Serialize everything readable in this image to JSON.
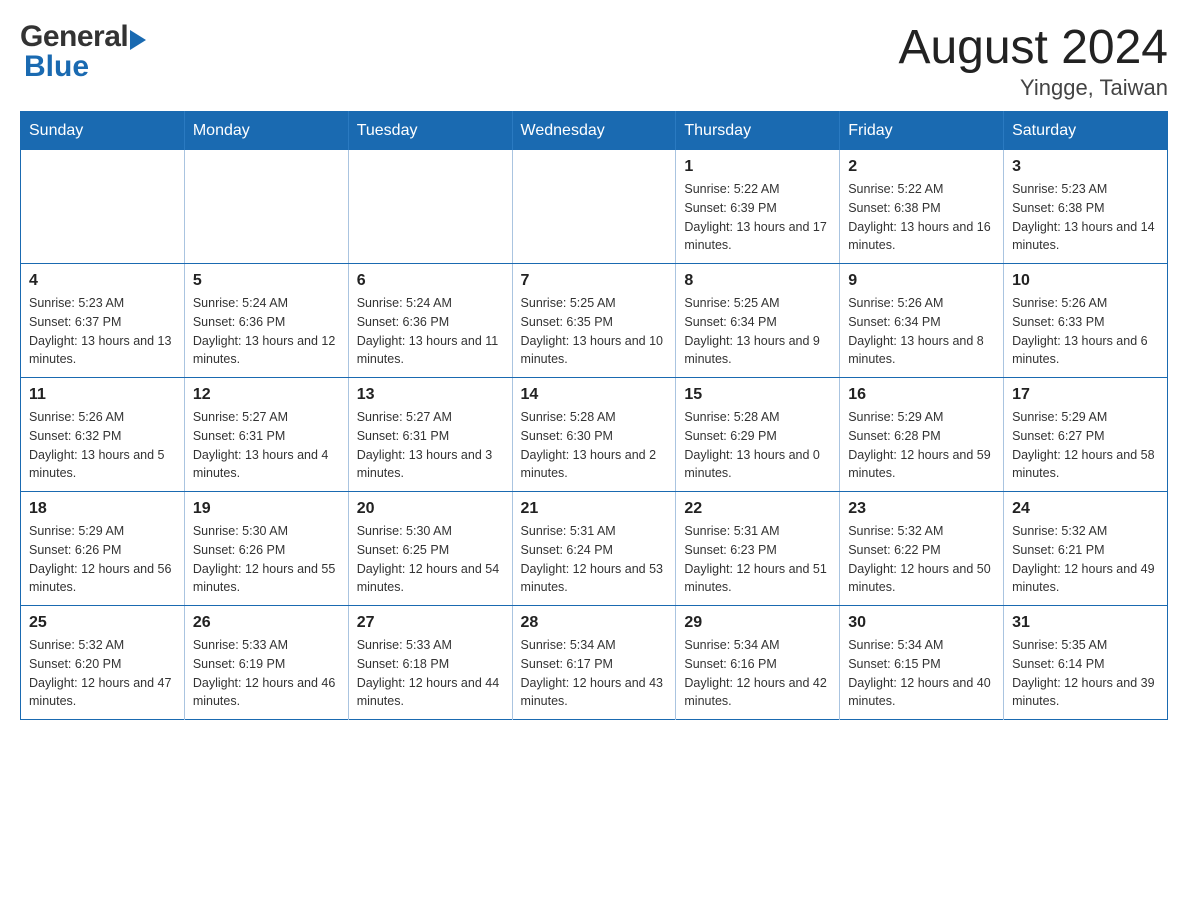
{
  "header": {
    "logo_general": "General",
    "logo_blue": "Blue",
    "title": "August 2024",
    "subtitle": "Yingge, Taiwan"
  },
  "weekdays": [
    "Sunday",
    "Monday",
    "Tuesday",
    "Wednesday",
    "Thursday",
    "Friday",
    "Saturday"
  ],
  "weeks": [
    [
      {
        "day": "",
        "sunrise": "",
        "sunset": "",
        "daylight": ""
      },
      {
        "day": "",
        "sunrise": "",
        "sunset": "",
        "daylight": ""
      },
      {
        "day": "",
        "sunrise": "",
        "sunset": "",
        "daylight": ""
      },
      {
        "day": "",
        "sunrise": "",
        "sunset": "",
        "daylight": ""
      },
      {
        "day": "1",
        "sunrise": "Sunrise: 5:22 AM",
        "sunset": "Sunset: 6:39 PM",
        "daylight": "Daylight: 13 hours and 17 minutes."
      },
      {
        "day": "2",
        "sunrise": "Sunrise: 5:22 AM",
        "sunset": "Sunset: 6:38 PM",
        "daylight": "Daylight: 13 hours and 16 minutes."
      },
      {
        "day": "3",
        "sunrise": "Sunrise: 5:23 AM",
        "sunset": "Sunset: 6:38 PM",
        "daylight": "Daylight: 13 hours and 14 minutes."
      }
    ],
    [
      {
        "day": "4",
        "sunrise": "Sunrise: 5:23 AM",
        "sunset": "Sunset: 6:37 PM",
        "daylight": "Daylight: 13 hours and 13 minutes."
      },
      {
        "day": "5",
        "sunrise": "Sunrise: 5:24 AM",
        "sunset": "Sunset: 6:36 PM",
        "daylight": "Daylight: 13 hours and 12 minutes."
      },
      {
        "day": "6",
        "sunrise": "Sunrise: 5:24 AM",
        "sunset": "Sunset: 6:36 PM",
        "daylight": "Daylight: 13 hours and 11 minutes."
      },
      {
        "day": "7",
        "sunrise": "Sunrise: 5:25 AM",
        "sunset": "Sunset: 6:35 PM",
        "daylight": "Daylight: 13 hours and 10 minutes."
      },
      {
        "day": "8",
        "sunrise": "Sunrise: 5:25 AM",
        "sunset": "Sunset: 6:34 PM",
        "daylight": "Daylight: 13 hours and 9 minutes."
      },
      {
        "day": "9",
        "sunrise": "Sunrise: 5:26 AM",
        "sunset": "Sunset: 6:34 PM",
        "daylight": "Daylight: 13 hours and 8 minutes."
      },
      {
        "day": "10",
        "sunrise": "Sunrise: 5:26 AM",
        "sunset": "Sunset: 6:33 PM",
        "daylight": "Daylight: 13 hours and 6 minutes."
      }
    ],
    [
      {
        "day": "11",
        "sunrise": "Sunrise: 5:26 AM",
        "sunset": "Sunset: 6:32 PM",
        "daylight": "Daylight: 13 hours and 5 minutes."
      },
      {
        "day": "12",
        "sunrise": "Sunrise: 5:27 AM",
        "sunset": "Sunset: 6:31 PM",
        "daylight": "Daylight: 13 hours and 4 minutes."
      },
      {
        "day": "13",
        "sunrise": "Sunrise: 5:27 AM",
        "sunset": "Sunset: 6:31 PM",
        "daylight": "Daylight: 13 hours and 3 minutes."
      },
      {
        "day": "14",
        "sunrise": "Sunrise: 5:28 AM",
        "sunset": "Sunset: 6:30 PM",
        "daylight": "Daylight: 13 hours and 2 minutes."
      },
      {
        "day": "15",
        "sunrise": "Sunrise: 5:28 AM",
        "sunset": "Sunset: 6:29 PM",
        "daylight": "Daylight: 13 hours and 0 minutes."
      },
      {
        "day": "16",
        "sunrise": "Sunrise: 5:29 AM",
        "sunset": "Sunset: 6:28 PM",
        "daylight": "Daylight: 12 hours and 59 minutes."
      },
      {
        "day": "17",
        "sunrise": "Sunrise: 5:29 AM",
        "sunset": "Sunset: 6:27 PM",
        "daylight": "Daylight: 12 hours and 58 minutes."
      }
    ],
    [
      {
        "day": "18",
        "sunrise": "Sunrise: 5:29 AM",
        "sunset": "Sunset: 6:26 PM",
        "daylight": "Daylight: 12 hours and 56 minutes."
      },
      {
        "day": "19",
        "sunrise": "Sunrise: 5:30 AM",
        "sunset": "Sunset: 6:26 PM",
        "daylight": "Daylight: 12 hours and 55 minutes."
      },
      {
        "day": "20",
        "sunrise": "Sunrise: 5:30 AM",
        "sunset": "Sunset: 6:25 PM",
        "daylight": "Daylight: 12 hours and 54 minutes."
      },
      {
        "day": "21",
        "sunrise": "Sunrise: 5:31 AM",
        "sunset": "Sunset: 6:24 PM",
        "daylight": "Daylight: 12 hours and 53 minutes."
      },
      {
        "day": "22",
        "sunrise": "Sunrise: 5:31 AM",
        "sunset": "Sunset: 6:23 PM",
        "daylight": "Daylight: 12 hours and 51 minutes."
      },
      {
        "day": "23",
        "sunrise": "Sunrise: 5:32 AM",
        "sunset": "Sunset: 6:22 PM",
        "daylight": "Daylight: 12 hours and 50 minutes."
      },
      {
        "day": "24",
        "sunrise": "Sunrise: 5:32 AM",
        "sunset": "Sunset: 6:21 PM",
        "daylight": "Daylight: 12 hours and 49 minutes."
      }
    ],
    [
      {
        "day": "25",
        "sunrise": "Sunrise: 5:32 AM",
        "sunset": "Sunset: 6:20 PM",
        "daylight": "Daylight: 12 hours and 47 minutes."
      },
      {
        "day": "26",
        "sunrise": "Sunrise: 5:33 AM",
        "sunset": "Sunset: 6:19 PM",
        "daylight": "Daylight: 12 hours and 46 minutes."
      },
      {
        "day": "27",
        "sunrise": "Sunrise: 5:33 AM",
        "sunset": "Sunset: 6:18 PM",
        "daylight": "Daylight: 12 hours and 44 minutes."
      },
      {
        "day": "28",
        "sunrise": "Sunrise: 5:34 AM",
        "sunset": "Sunset: 6:17 PM",
        "daylight": "Daylight: 12 hours and 43 minutes."
      },
      {
        "day": "29",
        "sunrise": "Sunrise: 5:34 AM",
        "sunset": "Sunset: 6:16 PM",
        "daylight": "Daylight: 12 hours and 42 minutes."
      },
      {
        "day": "30",
        "sunrise": "Sunrise: 5:34 AM",
        "sunset": "Sunset: 6:15 PM",
        "daylight": "Daylight: 12 hours and 40 minutes."
      },
      {
        "day": "31",
        "sunrise": "Sunrise: 5:35 AM",
        "sunset": "Sunset: 6:14 PM",
        "daylight": "Daylight: 12 hours and 39 minutes."
      }
    ]
  ]
}
